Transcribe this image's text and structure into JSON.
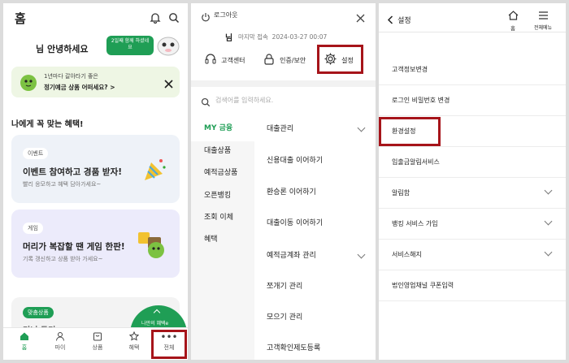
{
  "panel1": {
    "title": "홈",
    "greeting": "님 안녕하세요",
    "bubble": "2일째 함께 하셨네요",
    "promo_line1": "1년마다 갈아타기 좋은",
    "promo_line2": "정기예금 상품 어떠세요?",
    "promo_arrow": ">",
    "section_title": "나에게 꼭 맞는 혜택!",
    "card1": {
      "chip": "이벤트",
      "title": "이벤트 참여하고 경품 받자!",
      "sub": "빨리 응모하고 혜택 담아가세요~"
    },
    "card2": {
      "chip": "게임",
      "title": "머리가 복잡할 땐 게임 한판!",
      "sub": "기록 갱신하고 상품 받아 가세요~"
    },
    "card3": {
      "chip": "맞춤상품",
      "title": "미니 두기..."
    },
    "fab_label": "나만의 혜택e",
    "tabs": [
      {
        "label": "홈",
        "icon": "home-icon"
      },
      {
        "label": "마이",
        "icon": "person-icon"
      },
      {
        "label": "상품",
        "icon": "box-icon"
      },
      {
        "label": "혜택",
        "icon": "star-icon"
      },
      {
        "label": "전체",
        "icon": "more-icon"
      }
    ],
    "accent": "#1e8f4f"
  },
  "panel2": {
    "logout": "로그아웃",
    "user_suffix": "님",
    "last_login_label": "마지막 접속",
    "last_login": "2024-03-27 00:07",
    "quick": [
      {
        "label": "고객센터",
        "icon": "headset-icon"
      },
      {
        "label": "인증/보안",
        "icon": "lock-icon"
      },
      {
        "label": "설정",
        "icon": "gear-icon"
      }
    ],
    "search_placeholder": "검색어를 입력하세요.",
    "categories": [
      "MY 금융",
      "대출상품",
      "예적금상품",
      "오픈뱅킹",
      "조회 이체",
      "혜택"
    ],
    "items": [
      {
        "label": "대출관리",
        "chevron": true
      },
      {
        "label": "신용대출 이어하기",
        "chevron": false
      },
      {
        "label": "환승론 이어하기",
        "chevron": false
      },
      {
        "label": "대출이동 이어하기",
        "chevron": false
      },
      {
        "label": "예적금계좌 관리",
        "chevron": true
      },
      {
        "label": "쪼개기 관리",
        "chevron": false
      },
      {
        "label": "모으기 관리",
        "chevron": false
      },
      {
        "label": "고객확인제도등록",
        "chevron": false
      }
    ]
  },
  "panel3": {
    "back_label": "설정",
    "home_label": "홈",
    "menu_label": "전체메뉴",
    "rows": [
      {
        "label": "고객정보변경",
        "chevron": false
      },
      {
        "label": "로그인 비밀번호 변경",
        "chevron": false
      },
      {
        "label": "환경설정",
        "chevron": false
      },
      {
        "label": "입출금알림서비스",
        "chevron": false
      },
      {
        "label": "알림함",
        "chevron": true
      },
      {
        "label": "뱅킹 서비스 가입",
        "chevron": true
      },
      {
        "label": "서비스해지",
        "chevron": true
      },
      {
        "label": "법인영업채널 쿠폰입력",
        "chevron": false
      }
    ]
  }
}
